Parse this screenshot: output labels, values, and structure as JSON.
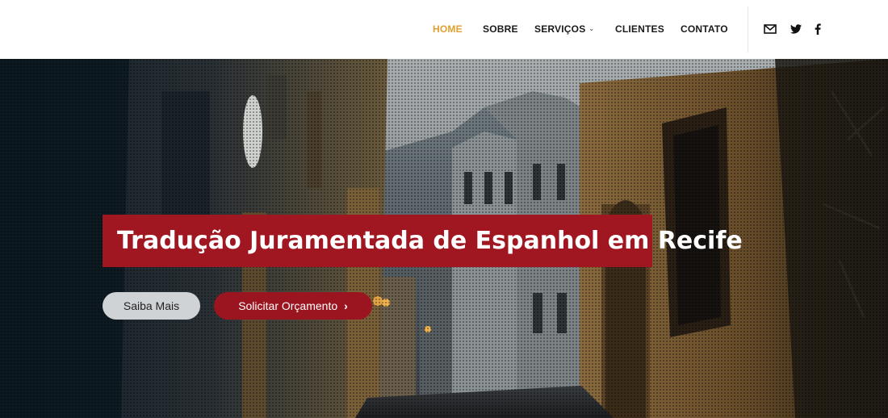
{
  "nav": {
    "items": [
      {
        "label": "HOME",
        "active": true
      },
      {
        "label": "SOBRE",
        "active": false
      },
      {
        "label": "SERVIÇOS",
        "active": false,
        "dropdown": true
      },
      {
        "label": "CLIENTES",
        "active": false
      },
      {
        "label": "CONTATO",
        "active": false
      }
    ],
    "dropdown_glyph": "⌄",
    "social_icons": [
      "mail-icon",
      "twitter-icon",
      "facebook-icon"
    ]
  },
  "hero": {
    "headline": "Tradução Juramentada de Espanhol em Recife",
    "primary_button": "Saiba Mais",
    "secondary_button": "Solicitar Orçamento",
    "secondary_button_arrow": "›"
  },
  "colors": {
    "active_nav": "#e0a030",
    "headline_bg": "#a01722",
    "quote_button_bg": "#9a1520",
    "more_button_bg": "#cfd3d6"
  }
}
